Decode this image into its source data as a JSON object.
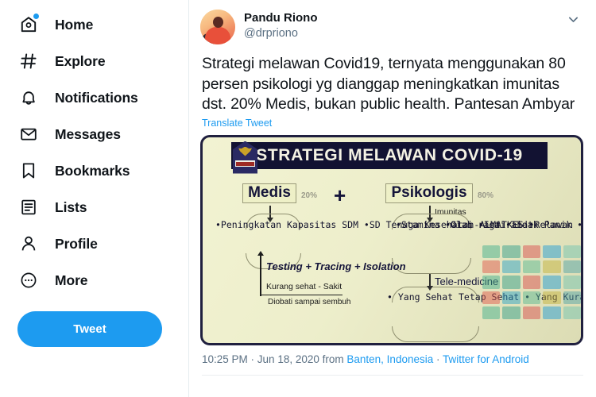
{
  "sidebar": {
    "items": [
      {
        "label": "Home",
        "icon": "home-icon",
        "badge": true
      },
      {
        "label": "Explore",
        "icon": "hashtag-icon",
        "badge": false
      },
      {
        "label": "Notifications",
        "icon": "bell-icon",
        "badge": false
      },
      {
        "label": "Messages",
        "icon": "envelope-icon",
        "badge": false
      },
      {
        "label": "Bookmarks",
        "icon": "bookmark-icon",
        "badge": false
      },
      {
        "label": "Lists",
        "icon": "list-icon",
        "badge": false
      },
      {
        "label": "Profile",
        "icon": "person-icon",
        "badge": false
      },
      {
        "label": "More",
        "icon": "more-circle-icon",
        "badge": false
      }
    ],
    "tweet_button": "Tweet"
  },
  "tweet": {
    "display_name": "Pandu Riono",
    "handle": "@drpriono",
    "text": "Strategi melawan Covid19,  ternyata menggunakan 80 persen psikologi yg dianggap meningkatkan imunitas dst. 20% Medis, bukan public health. Pantesan Ambyar",
    "translate_label": "Translate Tweet",
    "caret_icon": "chevron-down-icon",
    "footer": {
      "time": "10:25 PM",
      "sep1": " · ",
      "date": "Jun 18, 2020",
      "from_label": " from ",
      "location": "Banten, Indonesia",
      "sep2": " · ",
      "client": "Twitter for Android"
    }
  },
  "infographic": {
    "title": "STRATEGI MELAWAN COVID-19",
    "emblem": "garuda-emblem-icon",
    "left_box": "Medis",
    "left_pct": "20%",
    "plus": "+",
    "right_box": "Psikologis",
    "right_pct": "80%",
    "imunitas_label": "Imunitas",
    "telemedicine_label": "Tele-medicine",
    "left_list": "•Peningkatan Kapasitas SDM\n•SD Tenaga Kesehatan-ALMATKES\n•Relawan",
    "tti": "Testing + Tracing + Isolation",
    "kurang_sehat": "Kurang sehat - Sakit",
    "diobati": "Diobati sampai sembuh",
    "right_list_col1": "•Stamina\n•Gizi\n•Istirahat",
    "right_list_col2": "•Olah raga\n•Tidak Panik\n•Gembira",
    "right_bottom_list": "• Yang Sehat Tetap Sehat\n• Yang Kurang Sehat Jadi Sehat\n• Yang Sakit diobati sampai Sembuh"
  },
  "colors": {
    "accent": "#1d9bf0",
    "text": "#0f1419",
    "muted": "#5b7083",
    "border": "#e6ecf0",
    "infographic_border": "#20203f",
    "infographic_bg": "#edeecb"
  }
}
